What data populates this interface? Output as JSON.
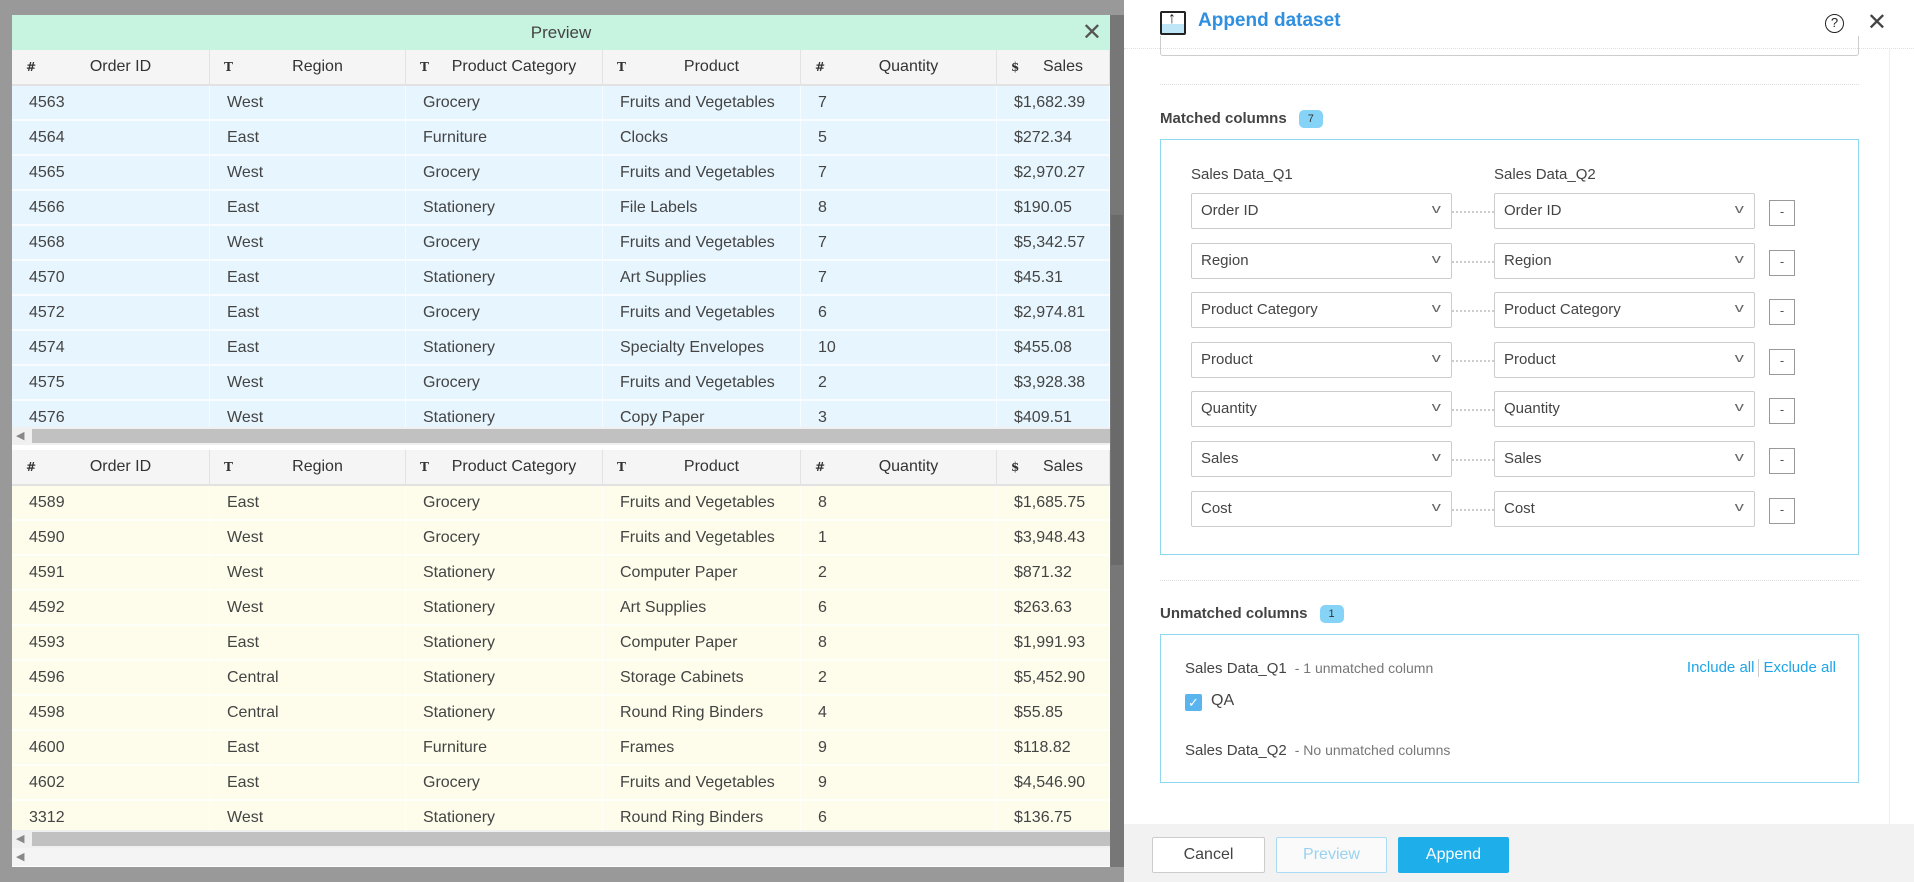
{
  "preview": {
    "title": "Preview",
    "columns": [
      {
        "label": "Order ID",
        "type_icon": "#"
      },
      {
        "label": "Region",
        "type_icon": "T"
      },
      {
        "label": "Product Category",
        "type_icon": "T"
      },
      {
        "label": "Product",
        "type_icon": "T"
      },
      {
        "label": "Quantity",
        "type_icon": "#"
      },
      {
        "label": "Sales",
        "type_icon": "$"
      }
    ],
    "table1_rows": [
      [
        "4563",
        "West",
        "Grocery",
        "Fruits and Vegetables",
        "7",
        "$1,682.39"
      ],
      [
        "4564",
        "East",
        "Furniture",
        "Clocks",
        "5",
        "$272.34"
      ],
      [
        "4565",
        "West",
        "Grocery",
        "Fruits and Vegetables",
        "7",
        "$2,970.27"
      ],
      [
        "4566",
        "East",
        "Stationery",
        "File Labels",
        "8",
        "$190.05"
      ],
      [
        "4568",
        "West",
        "Grocery",
        "Fruits and Vegetables",
        "7",
        "$5,342.57"
      ],
      [
        "4570",
        "East",
        "Stationery",
        "Art Supplies",
        "7",
        "$45.31"
      ],
      [
        "4572",
        "East",
        "Grocery",
        "Fruits and Vegetables",
        "6",
        "$2,974.81"
      ],
      [
        "4574",
        "East",
        "Stationery",
        "Specialty Envelopes",
        "10",
        "$455.08"
      ],
      [
        "4575",
        "West",
        "Grocery",
        "Fruits and Vegetables",
        "2",
        "$3,928.38"
      ],
      [
        "4576",
        "West",
        "Stationery",
        "Copy Paper",
        "3",
        "$409.51"
      ]
    ],
    "table2_rows": [
      [
        "4589",
        "East",
        "Grocery",
        "Fruits and Vegetables",
        "8",
        "$1,685.75"
      ],
      [
        "4590",
        "West",
        "Grocery",
        "Fruits and Vegetables",
        "1",
        "$3,948.43"
      ],
      [
        "4591",
        "West",
        "Stationery",
        "Computer Paper",
        "2",
        "$871.32"
      ],
      [
        "4592",
        "West",
        "Stationery",
        "Art Supplies",
        "6",
        "$263.63"
      ],
      [
        "4593",
        "East",
        "Stationery",
        "Computer Paper",
        "8",
        "$1,991.93"
      ],
      [
        "4596",
        "Central",
        "Stationery",
        "Storage Cabinets",
        "2",
        "$5,452.90"
      ],
      [
        "4598",
        "Central",
        "Stationery",
        "Round Ring Binders",
        "4",
        "$55.85"
      ],
      [
        "4600",
        "East",
        "Furniture",
        "Frames",
        "9",
        "$118.82"
      ],
      [
        "4602",
        "East",
        "Grocery",
        "Fruits and Vegetables",
        "9",
        "$4,546.90"
      ],
      [
        "3312",
        "West",
        "Stationery",
        "Round Ring Binders",
        "6",
        "$136.75"
      ]
    ],
    "colors": {
      "header": "#c6f4e0",
      "table1_bg": "#e6f5fe",
      "table2_bg": "#fefdeb"
    }
  },
  "panel": {
    "title": "Append dataset",
    "matched": {
      "label": "Matched columns",
      "count": "7",
      "left_dataset": "Sales Data_Q1",
      "right_dataset": "Sales Data_Q2",
      "pairs": [
        [
          "Order ID",
          "Order ID"
        ],
        [
          "Region",
          "Region"
        ],
        [
          "Product Category",
          "Product Category"
        ],
        [
          "Product",
          "Product"
        ],
        [
          "Quantity",
          "Quantity"
        ],
        [
          "Sales",
          "Sales"
        ],
        [
          "Cost",
          "Cost"
        ]
      ],
      "remove_label": "-"
    },
    "unmatched": {
      "label": "Unmatched columns",
      "count": "1",
      "q1_name": "Sales Data_Q1",
      "q1_sub": "- 1 unmatched column",
      "include_all": "Include all",
      "exclude_all": "Exclude all",
      "q1_column": {
        "label": "QA",
        "checked": true
      },
      "q2_name": "Sales Data_Q2",
      "q2_sub": "- No unmatched columns"
    },
    "buttons": {
      "cancel": "Cancel",
      "preview": "Preview",
      "append": "Append"
    },
    "accent": "#1eaeea"
  }
}
